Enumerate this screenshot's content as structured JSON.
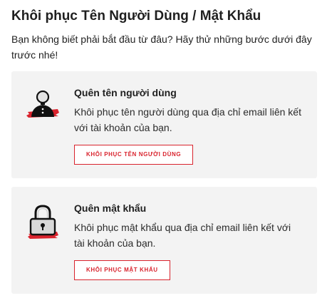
{
  "page": {
    "title": "Khôi phục Tên Người Dùng / Mật Khẩu",
    "intro": "Bạn không biết phải bắt đầu từ đâu? Hãy thử những bước dưới đây trước nhé!"
  },
  "cards": [
    {
      "icon": "user-icon",
      "title": "Quên tên người dùng",
      "description": "Khôi phục tên người dùng qua địa chỉ email liên kết với tài khoản của bạn.",
      "button_label": "KHÔI PHỤC TÊN NGƯỜI DÙNG"
    },
    {
      "icon": "padlock-icon",
      "title": "Quên mật khẩu",
      "description": "Khôi phục mật khẩu qua địa chỉ email liên kết với tài khoản của bạn.",
      "button_label": "KHÔI PHỤC MẬT KHẨU"
    }
  ],
  "colors": {
    "accent": "#d9232d",
    "card_background": "#f3f3f3",
    "text": "#1f1f1f"
  }
}
